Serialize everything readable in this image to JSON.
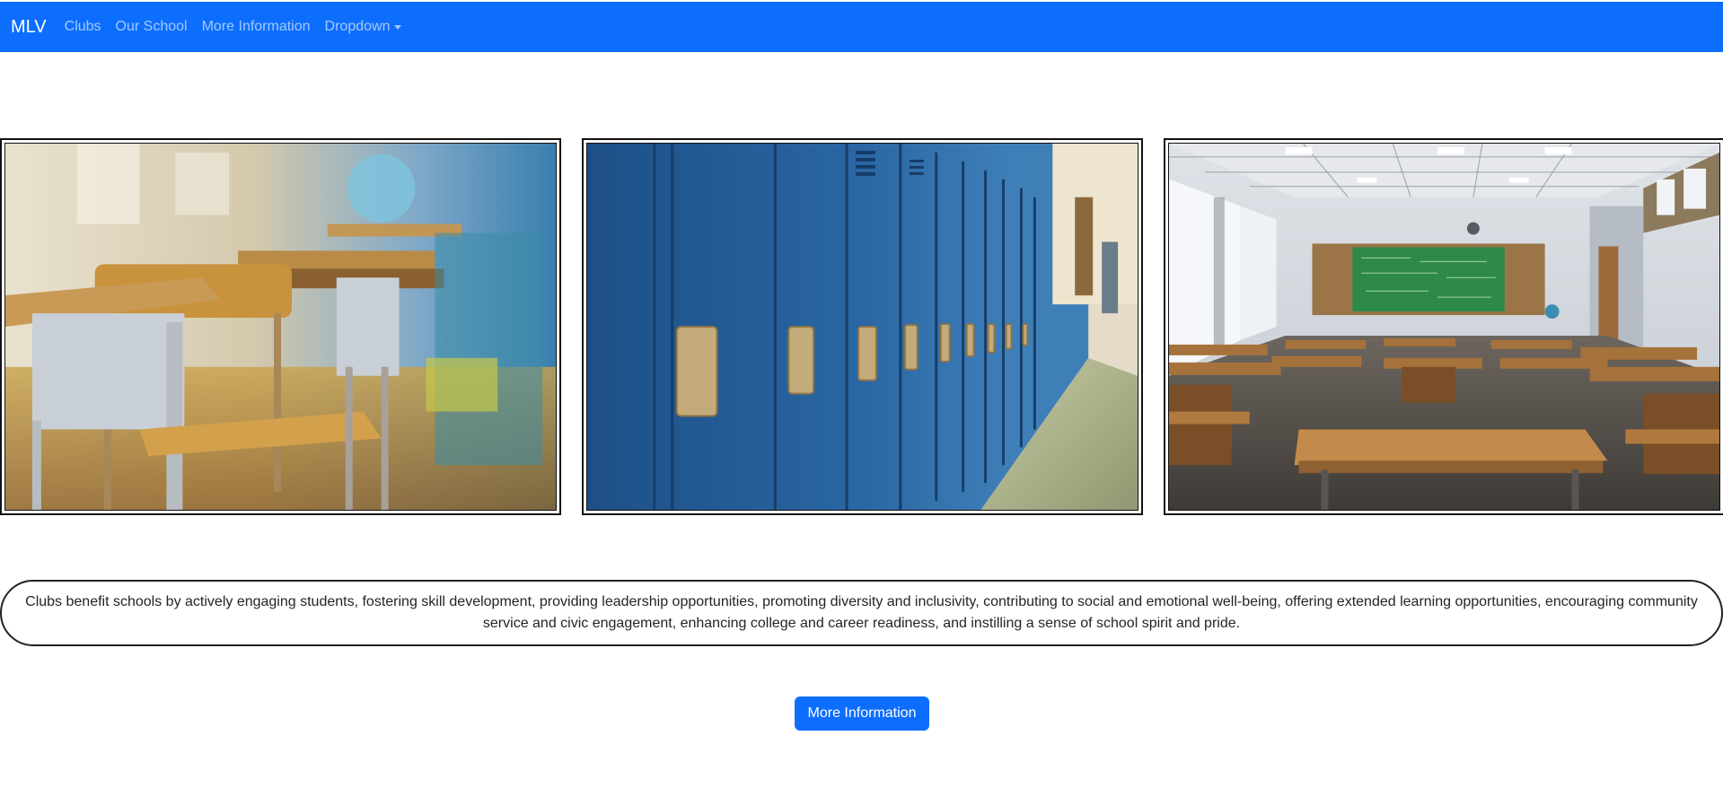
{
  "navbar": {
    "brand": "MLV",
    "links": [
      {
        "label": "Clubs"
      },
      {
        "label": "Our School"
      },
      {
        "label": "More Information"
      },
      {
        "label": "Dropdown"
      }
    ],
    "background": "#0d6efd"
  },
  "gallery": {
    "images": [
      {
        "subject": "classroom desks and chairs close-up"
      },
      {
        "subject": "blue school lockers in hallway"
      },
      {
        "subject": "empty classroom with chalkboard"
      }
    ]
  },
  "blurb": {
    "text": "Clubs benefit schools by actively engaging students, fostering skill development, providing leadership opportunities, promoting diversity and inclusivity, contributing to social and emotional well-being, offering extended learning opportunities, encouraging community service and civic engagement, enhancing college and career readiness, and instilling a sense of school spirit and pride."
  },
  "cta": {
    "label": "More Information",
    "color": "#0d6efd"
  }
}
